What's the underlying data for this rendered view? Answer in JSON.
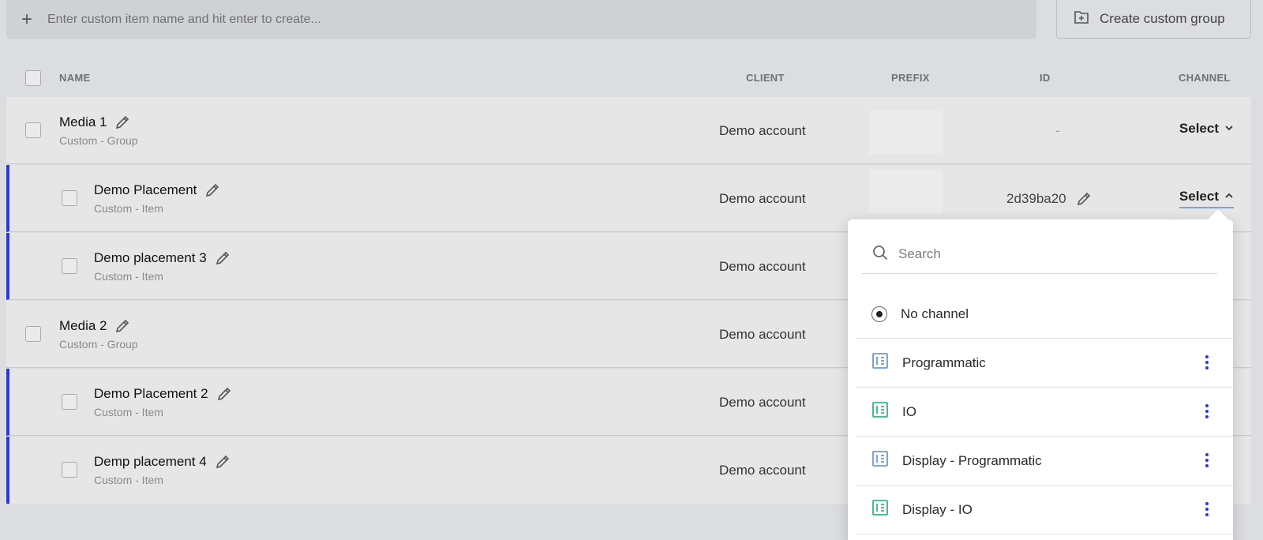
{
  "create_item": {
    "placeholder": "Enter custom item name and hit enter to create..."
  },
  "create_group_button": {
    "label": "Create custom group"
  },
  "table": {
    "headers": {
      "name": "NAME",
      "client": "CLIENT",
      "prefix": "PREFIX",
      "id": "ID",
      "channel": "CHANNEL"
    },
    "rows": [
      {
        "name": "Media 1",
        "type": "Custom - Group",
        "client": "Demo account",
        "id": "-",
        "channel": "Select"
      },
      {
        "name": "Demo Placement",
        "type": "Custom - Item",
        "client": "Demo account",
        "id": "2d39ba20",
        "channel": "Select"
      },
      {
        "name": "Demo placement 3",
        "type": "Custom - Item",
        "client": "Demo account"
      },
      {
        "name": "Media 2",
        "type": "Custom - Group",
        "client": "Demo account"
      },
      {
        "name": "Demo Placement 2",
        "type": "Custom - Item",
        "client": "Demo account"
      },
      {
        "name": "Demp placement 4",
        "type": "Custom - Item",
        "client": "Demo account"
      }
    ]
  },
  "channel_dropdown": {
    "search_placeholder": "Search",
    "options": [
      {
        "label": "No channel",
        "selected": true
      },
      {
        "label": "Programmatic",
        "icon": "channel-icon",
        "color": "#6b9bd6"
      },
      {
        "label": "IO",
        "icon": "channel-icon",
        "color": "#3fae8c"
      },
      {
        "label": "Display - Programmatic",
        "icon": "channel-icon",
        "color": "#6b9bd6"
      },
      {
        "label": "Display - IO",
        "icon": "channel-icon",
        "color": "#3fae8c"
      }
    ]
  },
  "colors": {
    "accent": "#2e37d6",
    "menu_dots": "#2e37d6"
  }
}
